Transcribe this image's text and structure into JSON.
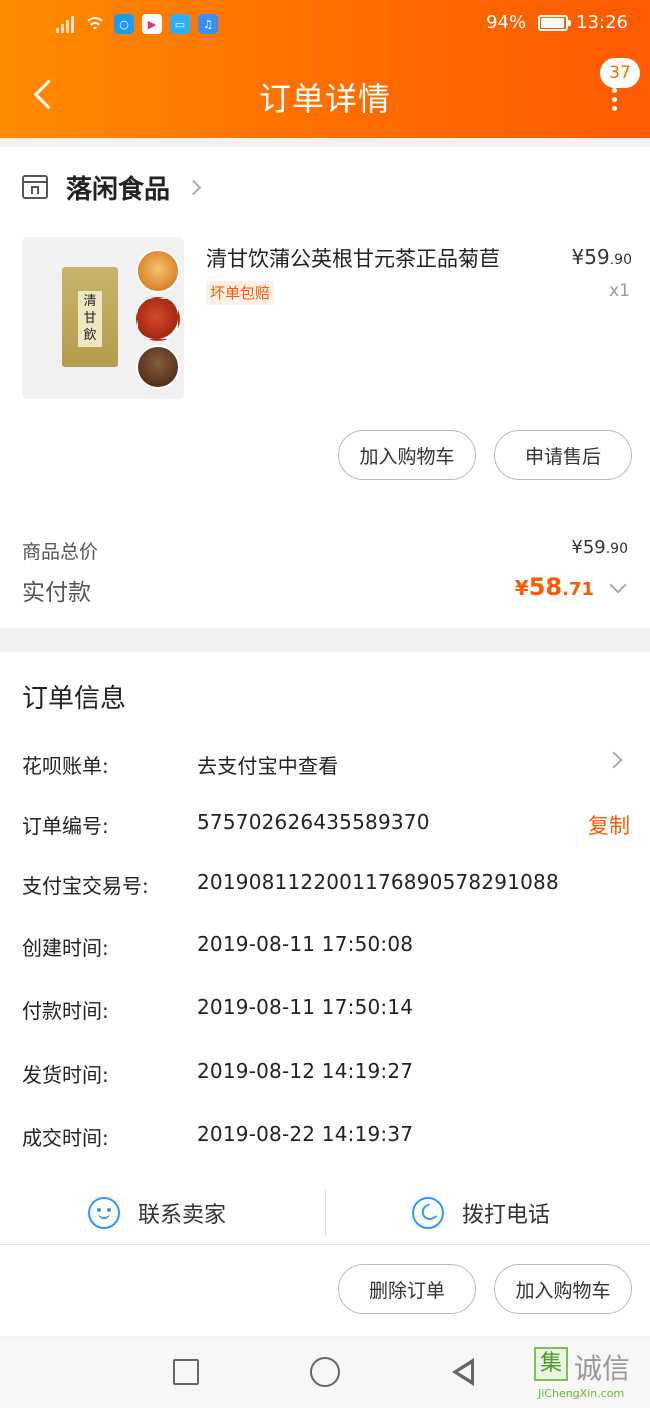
{
  "status_bar": {
    "battery": "94%",
    "time": "13:26",
    "app_icon_colors": [
      "#1e9bf0",
      "#ffffff",
      "#2bb0f0",
      "#3a8ff0"
    ]
  },
  "header": {
    "title": "订单详情",
    "badge": "37",
    "gradient": [
      "#ff8a00",
      "#ff5a00"
    ]
  },
  "shop": {
    "name": "落闲食品"
  },
  "product": {
    "name": "清甘饮蒲公英根甘元茶正品菊苣",
    "tag": "坏单包赔",
    "price_int": "¥59",
    "price_dec": ".90",
    "qty": "x1",
    "package_text": "清甘飲"
  },
  "actions": {
    "add_to_cart": "加入购物车",
    "after_sale": "申请售后"
  },
  "summary": {
    "subtotal_label": "商品总价",
    "subtotal_int": "¥59",
    "subtotal_dec": ".90",
    "paid_label": "实付款",
    "paid_symbol": "¥",
    "paid_int": "58",
    "paid_dec": ".71"
  },
  "order_info": {
    "title": "订单信息",
    "rows": [
      {
        "key": "花呗账单:",
        "value": "去支付宝中查看"
      },
      {
        "key": "订单编号:",
        "value": "575702626435589370",
        "action": "复制"
      },
      {
        "key": "支付宝交易号:",
        "value": "2019081122001176890578291088"
      },
      {
        "key": "创建时间:",
        "value": "2019-08-11 17:50:08"
      },
      {
        "key": "付款时间:",
        "value": "2019-08-11 17:50:14"
      },
      {
        "key": "发货时间:",
        "value": "2019-08-12 14:19:27"
      },
      {
        "key": "成交时间:",
        "value": "2019-08-22 14:19:37"
      }
    ]
  },
  "contact": {
    "seller": "联系卖家",
    "phone": "拨打电话",
    "icon_color": "#2b9bf4"
  },
  "bottom_actions": {
    "delete": "删除订单",
    "add_to_cart": "加入购物车"
  },
  "watermark": {
    "glyph": "集",
    "text": "诚信",
    "url": "JiChengXin.com"
  },
  "accent_color": "#ff5a00"
}
